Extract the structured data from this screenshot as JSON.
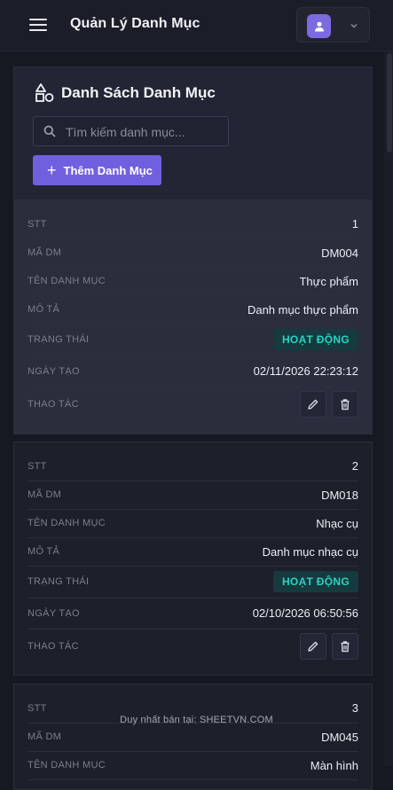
{
  "header": {
    "title": "Quản Lý Danh Mục"
  },
  "panel": {
    "title": "Danh Sách Danh Mục",
    "search_placeholder": "Tìm kiếm danh mục...",
    "add_button_label": "Thêm Danh Mục"
  },
  "labels": {
    "stt": "STT",
    "code": "MÃ DM",
    "name": "TÊN DANH MỤC",
    "description": "MÔ TẢ",
    "status": "TRẠNG THÁI",
    "created": "NGÀY TẠO",
    "actions": "THAO TÁC"
  },
  "items": [
    {
      "stt": "1",
      "code": "DM004",
      "name": "Thực phẩm",
      "description": "Danh mục thực phẩm",
      "status": "HOẠT ĐỘNG",
      "created": "02/11/2026 22:23:12"
    },
    {
      "stt": "2",
      "code": "DM018",
      "name": "Nhạc cụ",
      "description": "Danh mục nhạc cụ",
      "status": "HOẠT ĐỘNG",
      "created": "02/10/2026 06:50:56"
    },
    {
      "stt": "3",
      "code": "DM045",
      "name": "Màn hình"
    }
  ],
  "watermark": "Duy nhất bán tại: SHEETVN.COM",
  "colors": {
    "accent": "#7060e0",
    "status_text": "#2bd3c3",
    "status_bg": "#163a3e"
  },
  "icons": {
    "menu": "hamburger-menu-icon",
    "user": "user-avatar-icon",
    "dropdown": "chevron-down-icon",
    "category": "shapes-icon",
    "search": "search-icon",
    "add": "plus-icon",
    "edit": "pencil-icon",
    "delete": "trash-icon"
  }
}
